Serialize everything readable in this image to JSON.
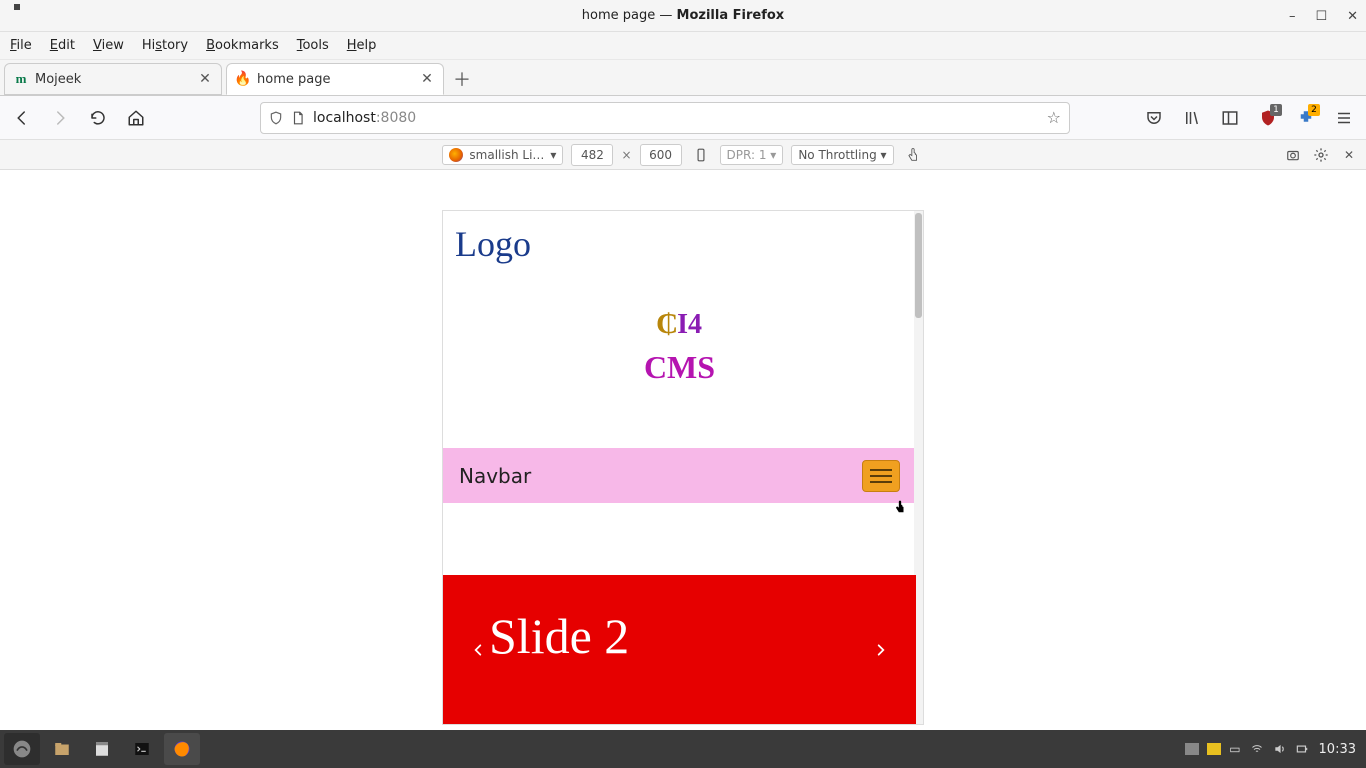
{
  "window": {
    "title_plain": "home page — Mozilla Firefox",
    "minimize": "–",
    "maximize": "☐",
    "close": "✕"
  },
  "menubar": {
    "file": "File",
    "edit": "Edit",
    "view": "View",
    "history": "History",
    "bookmarks": "Bookmarks",
    "tools": "Tools",
    "help": "Help"
  },
  "tabs": {
    "t0_label": "Mojeek",
    "t1_label": "home page"
  },
  "url": {
    "host": "localhost",
    "port": ":8080"
  },
  "rdm": {
    "device": "smallish Li…",
    "w": "482",
    "h": "600",
    "dpr": "DPR: 1",
    "throttle": "No Throttling"
  },
  "page": {
    "logo": "Logo",
    "ci_c": "₵",
    "ci_i4": "I4",
    "cms": "CMS",
    "navbar": "Navbar",
    "slide_label": "Slide 2"
  },
  "badge2": "2",
  "clock": "10:33"
}
